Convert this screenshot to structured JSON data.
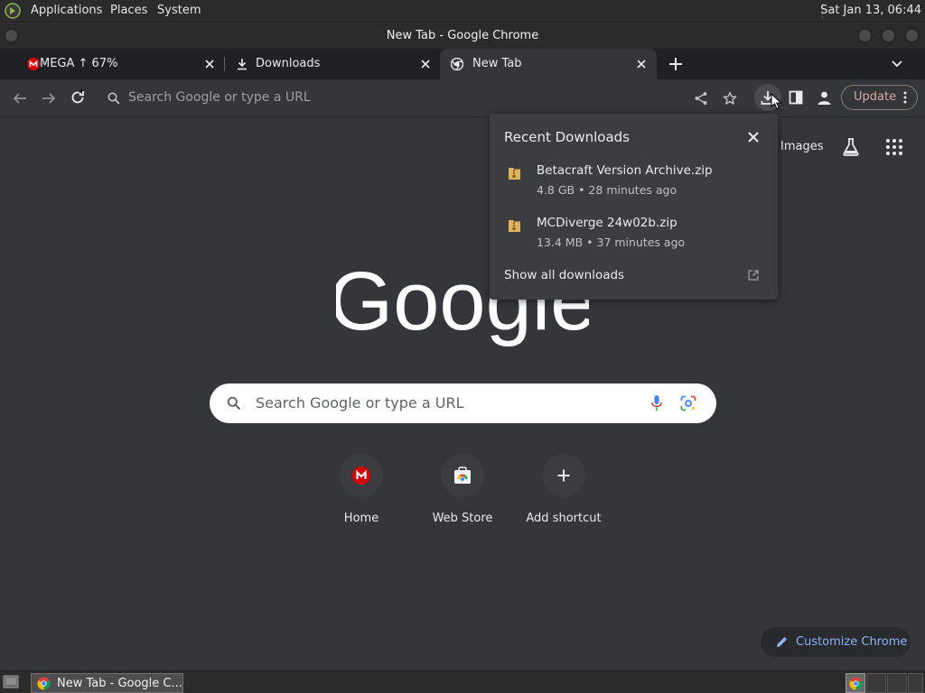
{
  "system_panel": {
    "menus": [
      "Applications",
      "Places",
      "System"
    ],
    "clock": "Sat Jan 13, 06:44"
  },
  "window": {
    "title": "New Tab - Google Chrome"
  },
  "tabs": [
    {
      "label": "MEGA ↑ 67%",
      "icon": "mega-icon"
    },
    {
      "label": "Downloads",
      "icon": "download-icon"
    },
    {
      "label": "New Tab",
      "icon": "chrome-icon"
    }
  ],
  "toolbar": {
    "omnibox_placeholder": "Search Google or type a URL",
    "update_label": "Update"
  },
  "ntp": {
    "images_link": "Images",
    "logo_text": "Google",
    "search_placeholder": "Search Google or type a URL",
    "shortcuts": [
      {
        "label": "Home",
        "icon": "mega-icon"
      },
      {
        "label": "Web Store",
        "icon": "web-store-icon"
      },
      {
        "label": "Add shortcut",
        "icon": "plus-icon"
      }
    ],
    "customize_label": "Customize Chrome"
  },
  "downloads_panel": {
    "title": "Recent Downloads",
    "items": [
      {
        "name": "Betacraft Version Archive.zip",
        "meta": "4.8 GB • 28 minutes ago"
      },
      {
        "name": "MCDiverge 24w02b.zip",
        "meta": "13.4 MB • 37 minutes ago"
      }
    ],
    "show_all": "Show all downloads"
  },
  "taskbar": {
    "window_label": "New Tab - Google C..."
  },
  "colors": {
    "accent_link": "#8ab4f8",
    "mega_red": "#d90007",
    "page_bg": "#35363a"
  }
}
